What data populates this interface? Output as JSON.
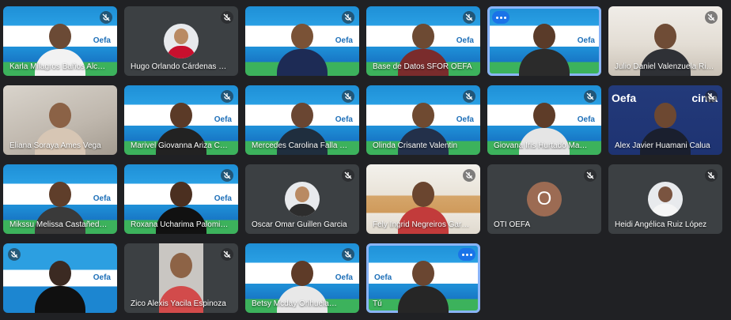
{
  "participants": [
    {
      "name": "Karla Milagros Baños Alc…"
    },
    {
      "name": "Hugo Orlando Cárdenas Ri…"
    },
    {
      "name": ""
    },
    {
      "name": "Base de Datos SFOR OEFA"
    },
    {
      "name": ""
    },
    {
      "name": "Julio Daniel Valenzuela Ri…"
    },
    {
      "name": "Eliana Soraya Ames Vega"
    },
    {
      "name": "Marivel Giovanna Ariza C…"
    },
    {
      "name": "Mercedes Carolina Falla …"
    },
    {
      "name": "Olinda Crisante Valentin"
    },
    {
      "name": "Giovana Iris Hurtado Ma…"
    },
    {
      "name": "Alex Javier Huamani Calua"
    },
    {
      "name": "Mikssu Melissa Castañed…"
    },
    {
      "name": "Roxana Ucharima Palomi…"
    },
    {
      "name": "Oscar Omar Guillen Garcia"
    },
    {
      "name": "Fely Ingrid Negreiros Gar…"
    },
    {
      "name": "OTI OEFA",
      "initial": "O"
    },
    {
      "name": "Heidi Angélica Ruiz López"
    },
    {
      "name": ""
    },
    {
      "name": "Zico Alexis Yacila Espinoza"
    },
    {
      "name": "Betsy Mcday Orihuela…"
    },
    {
      "name": "Tú"
    }
  ],
  "brand": {
    "oefa": "Oefa",
    "cinfa": "cinfa"
  },
  "colors": {
    "accent": "#8ab4f8",
    "bg": "#202124",
    "tile": "#3c4043"
  }
}
